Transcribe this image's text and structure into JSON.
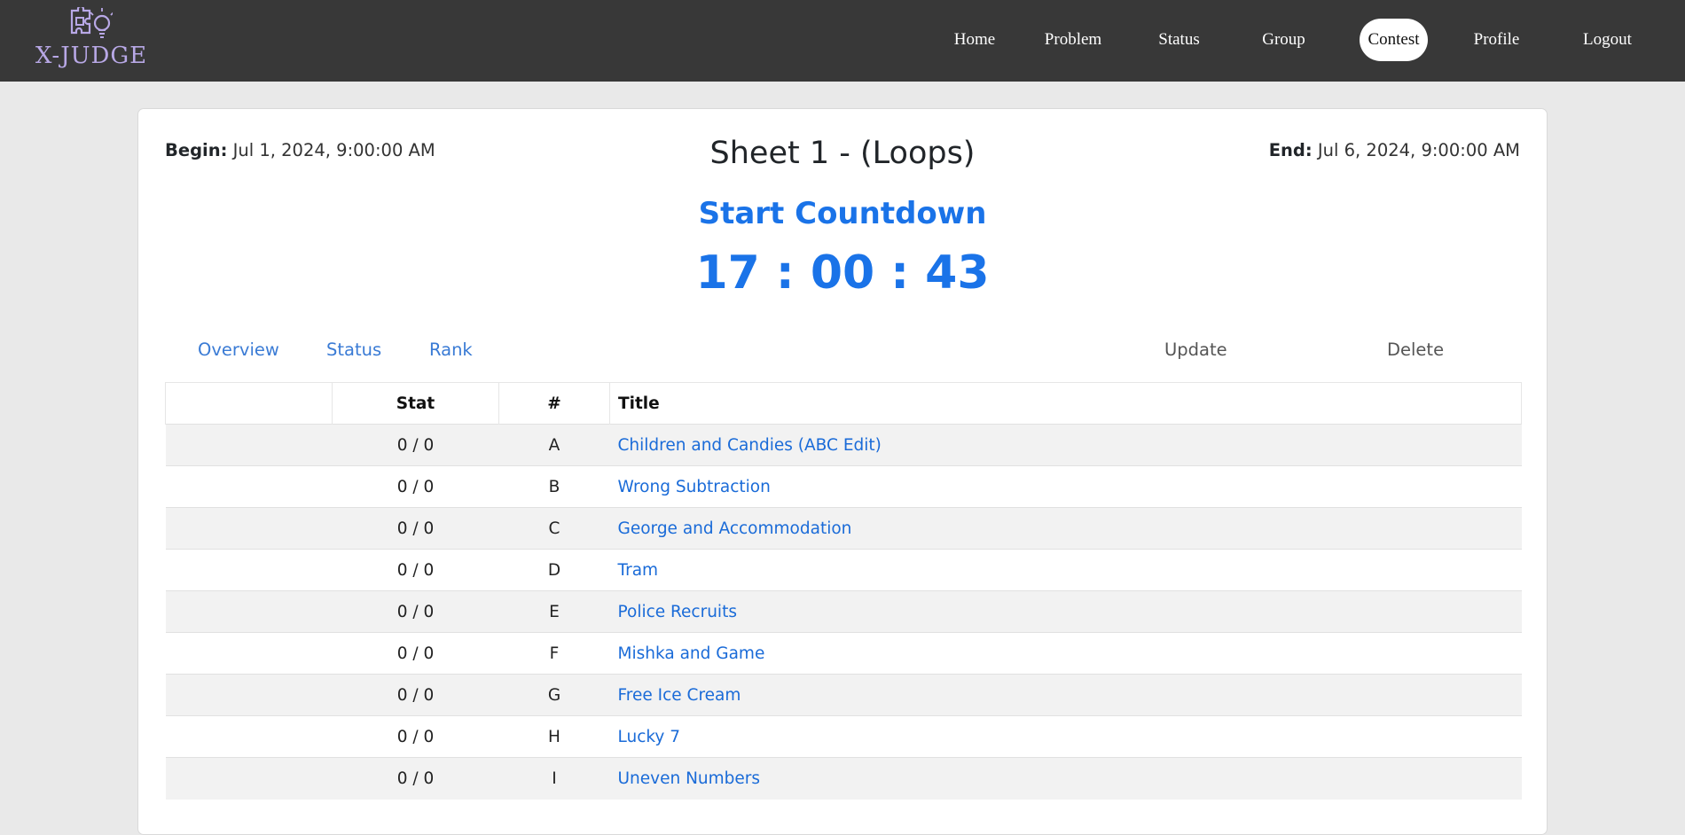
{
  "brand": {
    "name": "X-JUDGE",
    "icon": "puzzle-lightbulb-icon",
    "color": "#b8a8e6"
  },
  "nav": {
    "items": [
      {
        "label": "Home",
        "active": false
      },
      {
        "label": "Problem",
        "active": false
      },
      {
        "label": "Status",
        "active": false
      },
      {
        "label": "Group",
        "active": false
      },
      {
        "label": "Contest",
        "active": true
      },
      {
        "label": "Profile",
        "active": false
      },
      {
        "label": "Logout",
        "active": false
      }
    ]
  },
  "contest": {
    "begin_label": "Begin:",
    "begin_value": "Jul 1, 2024, 9:00:00 AM",
    "end_label": "End:",
    "end_value": "Jul 6, 2024, 9:00:00 AM",
    "title": "Sheet 1 - (Loops)",
    "countdown_label": "Start Countdown",
    "countdown": "17 : 00 : 43",
    "accent_color": "#1a73e8"
  },
  "tabs": [
    {
      "label": "Overview"
    },
    {
      "label": "Status"
    },
    {
      "label": "Rank"
    }
  ],
  "actions": {
    "update": "Update",
    "delete": "Delete"
  },
  "table": {
    "headers": {
      "blank": "",
      "stat": "Stat",
      "num": "#",
      "title": "Title"
    },
    "rows": [
      {
        "stat": "0 / 0",
        "num": "A",
        "title": "Children and Candies (ABC Edit)"
      },
      {
        "stat": "0 / 0",
        "num": "B",
        "title": "Wrong Subtraction"
      },
      {
        "stat": "0 / 0",
        "num": "C",
        "title": "George and Accommodation"
      },
      {
        "stat": "0 / 0",
        "num": "D",
        "title": "Tram"
      },
      {
        "stat": "0 / 0",
        "num": "E",
        "title": "Police Recruits"
      },
      {
        "stat": "0 / 0",
        "num": "F",
        "title": "Mishka and Game"
      },
      {
        "stat": "0 / 0",
        "num": "G",
        "title": "Free Ice Cream"
      },
      {
        "stat": "0 / 0",
        "num": "H",
        "title": "Lucky 7"
      },
      {
        "stat": "0 / 0",
        "num": "I",
        "title": "Uneven Numbers"
      }
    ]
  }
}
